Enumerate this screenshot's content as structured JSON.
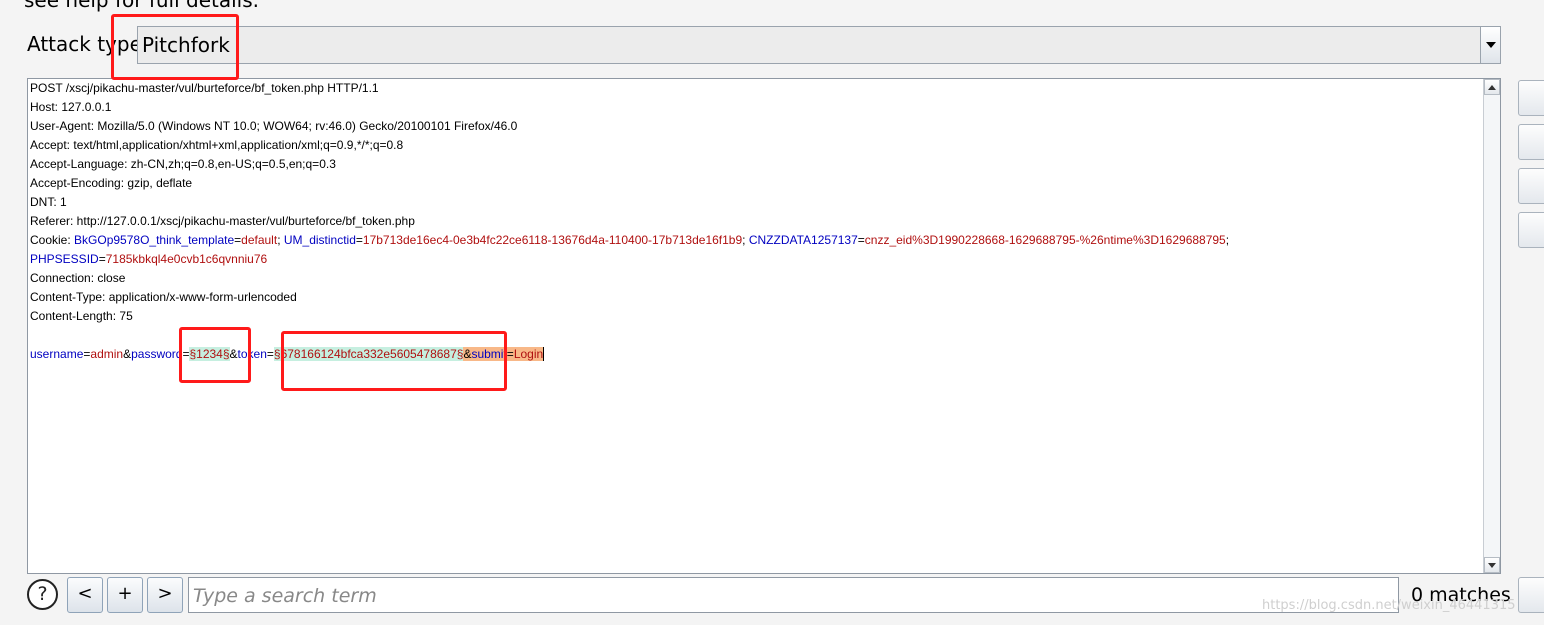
{
  "header": {
    "cut_text": "see help for full details.",
    "attack_type_label": "Attack type:",
    "attack_type_value": "Pitchfork"
  },
  "request": {
    "request_line": "POST /xscj/pikachu-master/vul/burteforce/bf_token.php HTTP/1.1",
    "headers": [
      "Host: 127.0.0.1",
      "User-Agent: Mozilla/5.0 (Windows NT 10.0; WOW64; rv:46.0) Gecko/20100101 Firefox/46.0",
      "Accept: text/html,application/xhtml+xml,application/xml;q=0.9,*/*;q=0.8",
      "Accept-Language: zh-CN,zh;q=0.8,en-US;q=0.5,en;q=0.3",
      "Accept-Encoding: gzip, deflate",
      "DNT: 1",
      "Referer: http://127.0.0.1/xscj/pikachu-master/vul/burteforce/bf_token.php"
    ],
    "cookie": {
      "label": "Cookie:",
      "c1_name": "BkGOp9578O_think_template",
      "c1_value": "default",
      "c2_name": "UM_distinctid",
      "c2_value": "17b713de16ec4-0e3b4fc22ce6118-13676d4a-110400-17b713de16f1b9",
      "c3_name": "CNZZDATA1257137",
      "c3_value": "cnzz_eid%3D1990228668-1629688795-%26ntime%3D1629688795",
      "c4_name": "PHPSESSID",
      "c4_value": "7185kbkql4e0cvb1c6qvnniu76"
    },
    "tail_headers": [
      "Connection: close",
      "Content-Type: application/x-www-form-urlencoded",
      "Content-Length: 75"
    ],
    "body": {
      "username_key": "username",
      "username_value": "admin",
      "password_key": "password",
      "password_payload": "§1234§",
      "token_key": "token",
      "token_payload": "§678166124bfca332e5605478687§",
      "submit_key": "submit",
      "submit_value": "Login"
    }
  },
  "search": {
    "prev_label": "<",
    "add_label": "+",
    "next_label": ">",
    "help_label": "?",
    "placeholder": "Type a search term",
    "matches": "0 matches"
  },
  "watermark": "https://blog.csdn.net/weixin_46441315",
  "colors": {
    "highlight_red": "#ff1a1a",
    "param_key": "#0000c0",
    "param_value": "#b01010",
    "payload_bg": "#c6efe0",
    "selection_bg": "#f8b888"
  }
}
